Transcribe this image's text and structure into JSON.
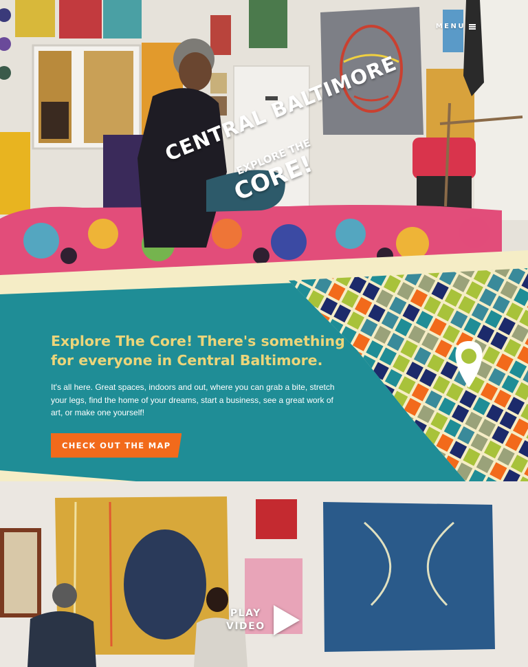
{
  "header": {
    "menu_label": "MENU",
    "menu_icon": "hamburger-icon"
  },
  "logo": {
    "line1": "CENTRAL BALTIMORE",
    "line2": "EXPLORE THE",
    "line3": "CORE!",
    "pin_icon": "map-pin-icon"
  },
  "intro": {
    "headline_line1": "Explore The Core! There's something",
    "headline_line2": "for everyone in Central Baltimore.",
    "body": "It's all here. Great spaces, indoors and out, where you can grab a bite, stretch your legs, find the home of your dreams, start a business, see a great work of art, or make one yourself!",
    "cta_label": "CHECK OUT THE MAP"
  },
  "video": {
    "play_line1": "PLAY",
    "play_line2": "VIDEO",
    "play_icon": "play-icon"
  },
  "colors": {
    "teal": "#1f8d96",
    "cream": "#f5edc6",
    "headline": "#ecd57a",
    "orange": "#f26a1b",
    "navy": "#1c2a6b",
    "lime": "#a8c23a"
  }
}
